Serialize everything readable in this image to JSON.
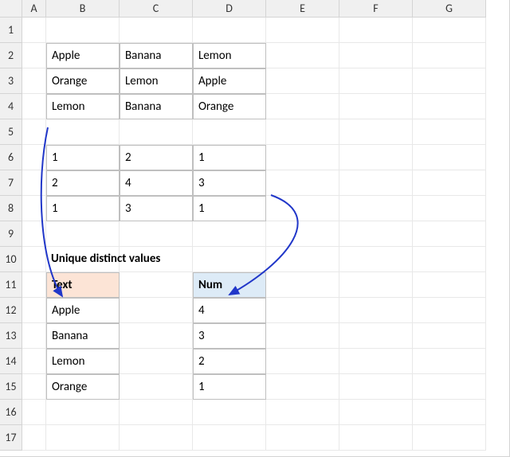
{
  "columns": [
    "A",
    "B",
    "C",
    "D",
    "E",
    "F",
    "G"
  ],
  "rowCount": 17,
  "table1": {
    "rows": [
      [
        "Apple",
        "Banana",
        "Lemon"
      ],
      [
        "Orange",
        "Lemon",
        "Apple"
      ],
      [
        "Lemon",
        "Banana",
        "Orange"
      ]
    ]
  },
  "table2": {
    "rows": [
      [
        "1",
        "2",
        "1"
      ],
      [
        "2",
        "4",
        "3"
      ],
      [
        "1",
        "3",
        "1"
      ]
    ]
  },
  "section_title": "Unique distinct values",
  "headers": {
    "text": "Text",
    "num": "Num"
  },
  "text_values": [
    "Apple",
    "Banana",
    "Lemon",
    "Orange"
  ],
  "num_values": [
    "4",
    "3",
    "2",
    "1"
  ],
  "chart_data": {
    "type": "table",
    "tables": [
      {
        "title": "Fruit grid",
        "columns": [
          "B",
          "C",
          "D"
        ],
        "rows": [
          [
            "Apple",
            "Banana",
            "Lemon"
          ],
          [
            "Orange",
            "Lemon",
            "Apple"
          ],
          [
            "Lemon",
            "Banana",
            "Orange"
          ]
        ]
      },
      {
        "title": "Number grid",
        "columns": [
          "B",
          "C",
          "D"
        ],
        "rows": [
          [
            1,
            2,
            1
          ],
          [
            2,
            4,
            3
          ],
          [
            1,
            3,
            1
          ]
        ]
      },
      {
        "title": "Unique distinct values",
        "columns": [
          "Text",
          "Num"
        ],
        "rows": [
          [
            "Apple",
            4
          ],
          [
            "Banana",
            3
          ],
          [
            "Lemon",
            2
          ],
          [
            "Orange",
            1
          ]
        ]
      }
    ]
  }
}
